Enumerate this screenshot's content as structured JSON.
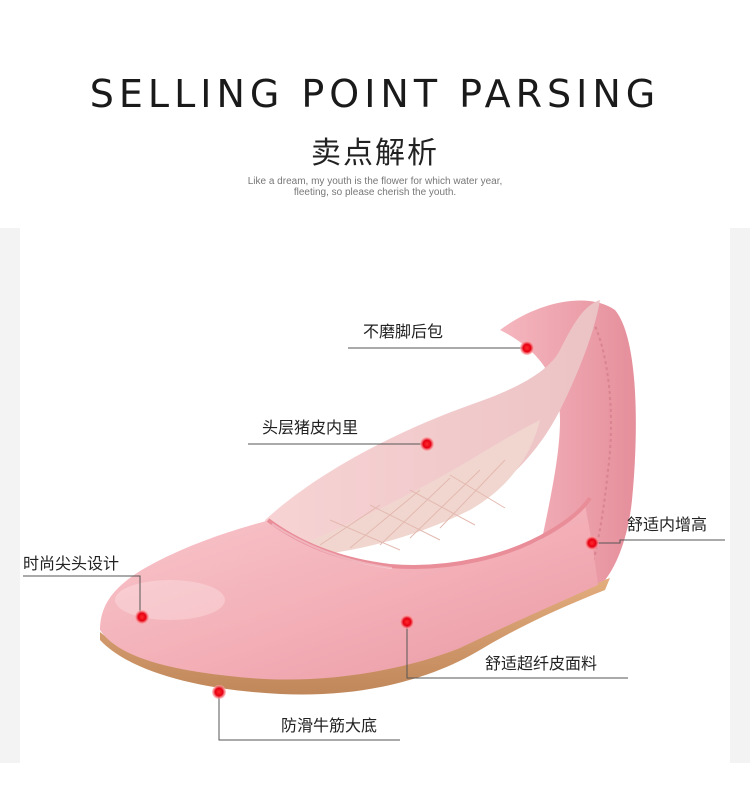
{
  "header": {
    "title_en": "SELLING POINT PARSING",
    "title_cn": "卖点解析",
    "tagline_line1": "Like a dream, my youth is the flower for which water year,",
    "tagline_line2": "fleeting, so please cherish the youth."
  },
  "callouts": {
    "heel_counter": "不磨脚后包",
    "lining": "头层猪皮内里",
    "inner_height": "舒适内增高",
    "pointed_toe": "时尚尖头设计",
    "upper_material": "舒适超纤皮面料",
    "outsole": "防滑牛筋大底"
  },
  "colors": {
    "marker": "#e60012",
    "shoe_pink": "#f4b7bd",
    "sole_tan": "#d39a6a"
  }
}
